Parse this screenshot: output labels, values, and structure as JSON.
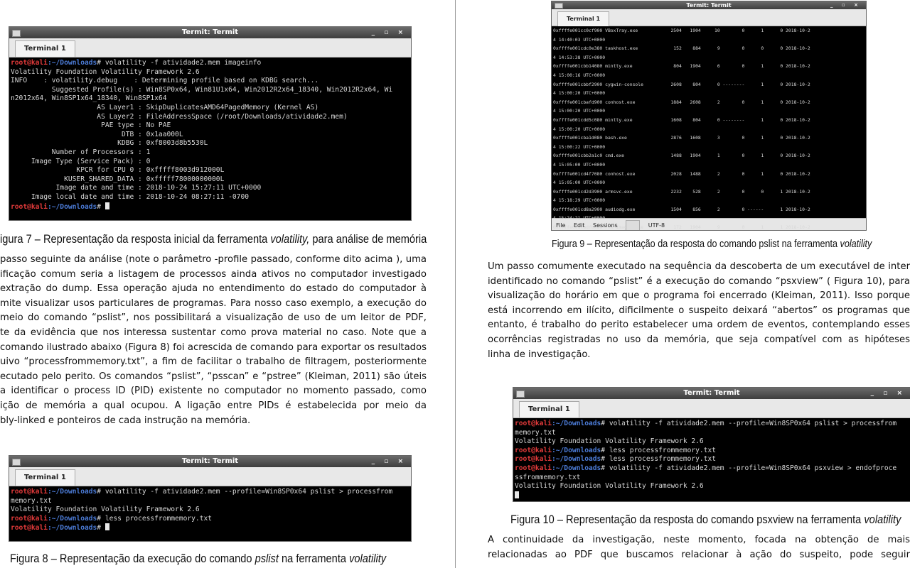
{
  "left_page": {
    "figure7": {
      "window_title": "Termit: Termit",
      "window_buttons": "_ ▫ ×",
      "tab_label": "Terminal 1",
      "lines": [
        {
          "prompt_user": "root@kali",
          "prompt_path": ":~/Downloads",
          "text": "# volatility -f atividade2.mem imageinfo"
        },
        {
          "text": "Volatility Foundation Volatility Framework 2.6"
        },
        {
          "text": "INFO    : volatility.debug    : Determining profile based on KDBG search..."
        },
        {
          "text": "          Suggested Profile(s) : Win8SP0x64, Win81U1x64, Win2012R2x64_18340, Win2012R2x64, Wi"
        },
        {
          "text": "n2012x64, Win8SP1x64_18340, Win8SP1x64"
        },
        {
          "text": "                     AS Layer1 : SkipDuplicatesAMD64PagedMemory (Kernel AS)"
        },
        {
          "text": "                     AS Layer2 : FileAddressSpace (/root/Downloads/atividade2.mem)"
        },
        {
          "text": "                      PAE type : No PAE"
        },
        {
          "text": "                           DTB : 0x1aa000L"
        },
        {
          "text": "                          KDBG : 0xf8003d8b5530L"
        },
        {
          "text": "          Number of Processors : 1"
        },
        {
          "text": "     Image Type (Service Pack) : 0"
        },
        {
          "text": "                KPCR for CPU 0 : 0xfffff8003d912000L"
        },
        {
          "text": "             KUSER_SHARED_DATA : 0xfffff78000000000L"
        },
        {
          "text": "           Image date and time : 2018-10-24 15:27:11 UTC+0000"
        },
        {
          "text": "     Image local date and time : 2018-10-24 08:27:11 -0700"
        },
        {
          "prompt_user": "root@kali",
          "prompt_path": ":~/Downloads",
          "text": "# ",
          "cursor": true
        }
      ]
    },
    "caption7": {
      "prefix": "igura 7 – Representação da resposta inicial da ferramenta ",
      "italic": "volatility,",
      "suffix": " para análise de memória"
    },
    "paragraph": [
      " passo seguinte da análise (note o parâmetro -profile passado, conforme dito acima ), uma",
      "ificação comum seria a listagem de processos ainda ativos no computador investigado quando",
      "extração do dump. Essa operação ajuda no entendimento do estado do computador à época, e",
      "mite visualizar usos particulares de programas. Para nosso caso exemplo, a execução do passo,",
      " meio do comando “pslist”, nos possibilitará a visualização de uso de um leitor de PDF, como",
      "te da evidência que nos interessa sustentar como prova material no caso. Note que a execução",
      "comando ilustrado abaixo (Figura 8) foi acrescida de comando para exportar os resultados no",
      "uivo “processfrommemory.txt”, a fim de facilitar o trabalho de filtragem, posteriormente",
      "ecutado pelo perito. Os comandos “pslist”, “psscan” e “pstree” (Kleiman, 2011) são úteis também",
      "a identificar o process ID (PID) existente no computador no momento passado, como também a",
      "ição de memória a qual ocupou. A ligação entre PIDs é estabelecida por meio da verificação do",
      "bly-linked e ponteiros de cada instrução na memória."
    ],
    "figure8": {
      "window_title": "Termit: Termit",
      "window_buttons": "_ ▫ ×",
      "tab_label": "Terminal 1",
      "lines": [
        {
          "prompt_user": "root@kali",
          "prompt_path": ":~/Downloads",
          "text": "# volatility -f atividade2.mem --profile=Win8SP0x64 pslist > processfrom"
        },
        {
          "text": "memory.txt"
        },
        {
          "text": "Volatility Foundation Volatility Framework 2.6"
        },
        {
          "prompt_user": "root@kali",
          "prompt_path": ":~/Downloads",
          "text": "# less processfrommemory.txt"
        },
        {
          "prompt_user": "root@kali",
          "prompt_path": ":~/Downloads",
          "text": "# ",
          "cursor": true
        }
      ]
    },
    "caption8": {
      "prefix": "Figura 8 – Representação da execução do comando ",
      "italic": "pslist",
      "suffix": " na ferramenta ",
      "italic2": "volatility"
    }
  },
  "right_page": {
    "figure9": {
      "window_title": "Termit: Termit",
      "window_buttons": "_ ▫ ×",
      "tab_label": "Terminal 1",
      "lines": [
        {
          "text": "0xffffe001cc0cf900 VBoxTray.exe            2504   1904     10        0      1      0 2018-10-2"
        },
        {
          "text": "4 14:40:03 UTC+0000"
        },
        {
          "text": "0xffffe001cdc0e380 taskhost.exe             152    884      9        0      0      0 2018-10-2"
        },
        {
          "text": "4 14:53:38 UTC+0000"
        },
        {
          "text": "0xffffe001cbb14080 mintty.exe               804   1904      6        0      1      0 2018-10-2"
        },
        {
          "text": "4 15:00:16 UTC+0000"
        },
        {
          "text": "0xffffe001cbbf2900 cygwin-console          2608    804      0 --------      1      0 2018-10-2"
        },
        {
          "text": "4 15:00:20 UTC+0000"
        },
        {
          "text": "0xffffe001cbafd900 conhost.exe             1884   2608      2        0      1      0 2018-10-2"
        },
        {
          "text": "4 15:00:20 UTC+0000"
        },
        {
          "text": "0xffffe001cdd5c080 mintty.exe              1608    804      0 --------      1      0 2018-10-2"
        },
        {
          "text": "4 15:00:20 UTC+0000"
        },
        {
          "text": "0xffffe001cba1d080 bash.exe                2876   1608      3        0      1      0 2018-10-2"
        },
        {
          "text": "4 15:00:22 UTC+0000"
        },
        {
          "text": "0xffffe001cbb2a1c0 cmd.exe                 1488   1904      1        0      1      0 2018-10-2"
        },
        {
          "text": "4 15:05:00 UTC+0000"
        },
        {
          "text": "0xffffe001cd4f7080 conhost.exe             2028   1488      2        0      1      0 2018-10-2"
        },
        {
          "text": "4 15:05:00 UTC+0000"
        },
        {
          "text": "0xffffe001cd2d3900 armsvc.exe              2232    528      2        0      0      1 2018-10-2"
        },
        {
          "text": "4 15:18:29 UTC+0000"
        },
        {
          "text": "0xffffe001cd8a2900 audiodg.exe             1504    856      2        0 ------      1 2018-10-2"
        },
        {
          "text": "4 15:24:21 UTC+0000"
        },
        {
          "text": "0xffffe001cbdfb080 FTK Imager.exe           172   1904      9        0      1      1 2018-10-2"
        },
        {
          "text": "4 15:25:04 UTC+0000"
        },
        {
          "text": "0xffffe001cb931080 AcroRd32.exe            2868   1904     13        0      1      1 2018-10-2"
        },
        {
          "text": "4 15:25:31 UTC+0000"
        },
        {
          "text": "",
          "cursor": true
        }
      ],
      "menubar": {
        "file": "File",
        "edit": "Edit",
        "sessions": "Sessions",
        "encoding": "UTF-8"
      }
    },
    "caption9": {
      "prefix": "Figura 9 – Representação da resposta do comando pslist na ferramenta ",
      "italic": "volatility"
    },
    "paragraph": [
      "Um passo comumente executado na sequência da descoberta de um executável de inter",
      "identificado no comando “pslist” é a execução do comando “psxview” ( Figura 10), para possibilit",
      "visualização do horário em que o programa foi encerrado (Kleiman, 2011). Isso porque sabendo",
      "está incorrendo em ilícito, dificilmente o suspeito deixará “abertos” os programas que utilizou",
      "entanto, é trabalho do perito estabelecer uma ordem de eventos, contemplando esses horários",
      "ocorrências registradas no uso da memória, que seja compatível com as hipóteses levantada",
      "linha de investigação."
    ],
    "figure10": {
      "window_title": "Termit: Termit",
      "window_buttons": "_ ▫ ×",
      "tab_label": "Terminal 1",
      "lines": [
        {
          "prompt_user": "root@kali",
          "prompt_path": ":~/Downloads",
          "text": "# volatility -f atividade2.mem --profile=Win8SP0x64 pslist > processfrom"
        },
        {
          "text": "memory.txt"
        },
        {
          "text": "Volatility Foundation Volatility Framework 2.6"
        },
        {
          "prompt_user": "root@kali",
          "prompt_path": ":~/Downloads",
          "text": "# less processfrommemory.txt"
        },
        {
          "prompt_user": "root@kali",
          "prompt_path": ":~/Downloads",
          "text": "# less processfrommemory.txt"
        },
        {
          "prompt_user": "root@kali",
          "prompt_path": ":~/Downloads",
          "text": "# volatility -f atividade2.mem --profile=Win8SP0x64 psxview > endofproce"
        },
        {
          "text": "ssfrommemory.txt"
        },
        {
          "text": "Volatility Foundation Volatility Framework 2.6"
        },
        {
          "text": "",
          "cursor": true
        }
      ]
    },
    "caption10": {
      "prefix": "Figura 10 – Representação da resposta do comando psxview na ferramenta ",
      "italic": "volatility"
    },
    "paragraph2": [
      "A continuidade da investigação, neste momento, focada na obtenção de mais informações",
      "relacionadas ao PDF que buscamos relacionar à ação do suspeito, pode seguir analisando textos"
    ]
  }
}
